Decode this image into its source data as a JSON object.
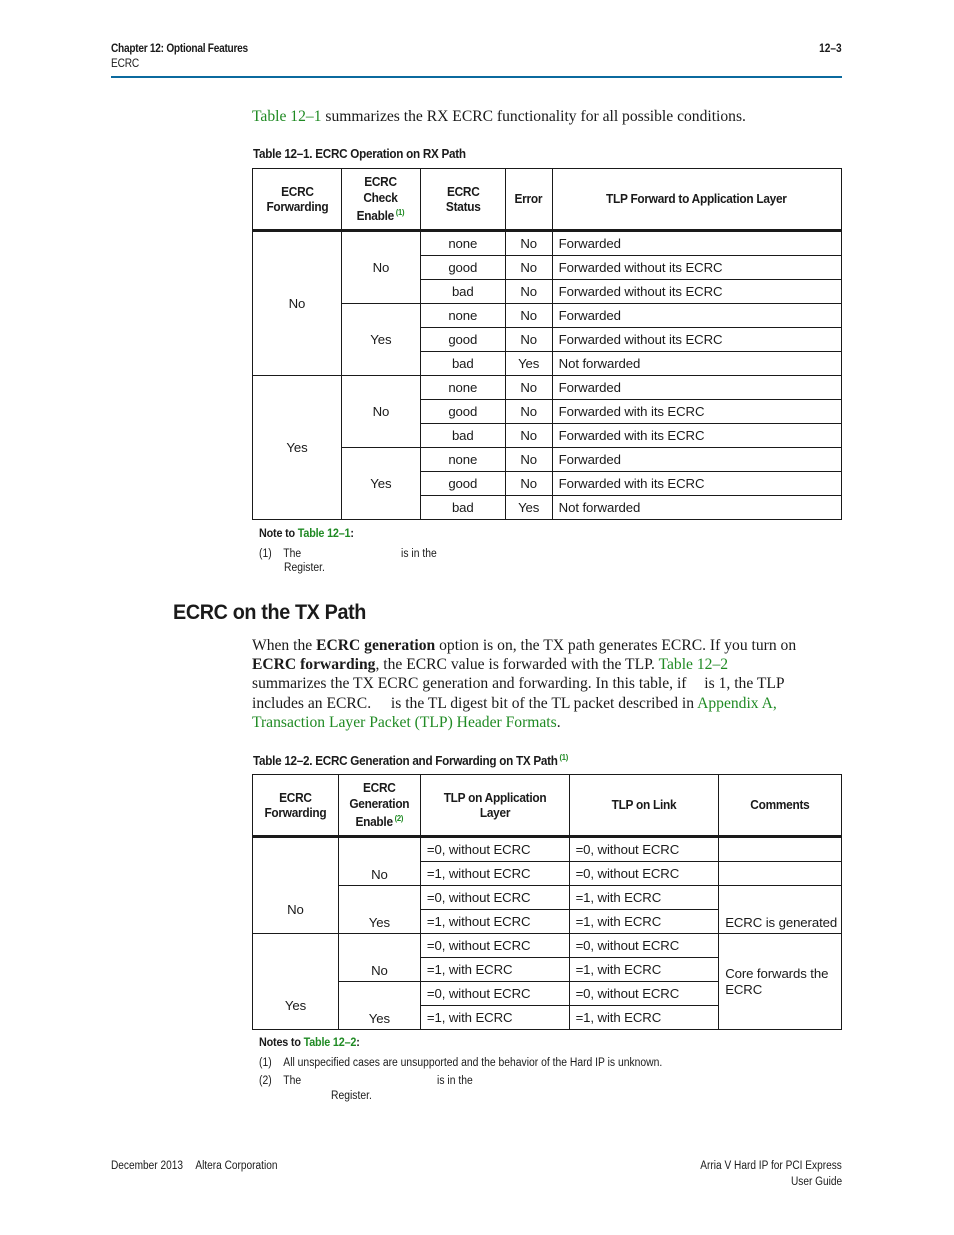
{
  "header": {
    "chapter": "Chapter 12:  Optional Features",
    "section": "ECRC",
    "page_number": "12–3",
    "rule_color": "#0b6a9e"
  },
  "intro": {
    "link": "Table 12–1",
    "text": " summarizes the RX ECRC functionality for all possible conditions."
  },
  "table1": {
    "caption": "Table 12–1.  ECRC Operation on RX Path",
    "headers": {
      "forwarding": [
        "ECRC",
        "Forwarding"
      ],
      "check_enable": [
        "ECRC",
        "Check",
        "Enable"
      ],
      "check_enable_note": "(1)",
      "status": [
        "ECRC",
        "Status"
      ],
      "error": "Error",
      "tlp_forward": "TLP Forward to Application Layer"
    },
    "groups": [
      {
        "forwarding": "No",
        "subgroups": [
          {
            "check_enable": "No",
            "rows": [
              {
                "status": "none",
                "error": "No",
                "result": "Forwarded"
              },
              {
                "status": "good",
                "error": "No",
                "result": "Forwarded without its ECRC"
              },
              {
                "status": "bad",
                "error": "No",
                "result": "Forwarded without its ECRC"
              }
            ]
          },
          {
            "check_enable": "Yes",
            "rows": [
              {
                "status": "none",
                "error": "No",
                "result": "Forwarded"
              },
              {
                "status": "good",
                "error": "No",
                "result": "Forwarded without its ECRC"
              },
              {
                "status": "bad",
                "error": "Yes",
                "result": "Not forwarded"
              }
            ]
          }
        ]
      },
      {
        "forwarding": "Yes",
        "subgroups": [
          {
            "check_enable": "No",
            "rows": [
              {
                "status": "none",
                "error": "No",
                "result": "Forwarded"
              },
              {
                "status": "good",
                "error": "No",
                "result": "Forwarded with its ECRC"
              },
              {
                "status": "bad",
                "error": "No",
                "result": "Forwarded with its ECRC"
              }
            ]
          },
          {
            "check_enable": "Yes",
            "rows": [
              {
                "status": "none",
                "error": "No",
                "result": "Forwarded"
              },
              {
                "status": "good",
                "error": "No",
                "result": "Forwarded with its ECRC"
              },
              {
                "status": "bad",
                "error": "Yes",
                "result": "Not forwarded"
              }
            ]
          }
        ]
      }
    ],
    "notes_title_prefix": "Note to ",
    "notes_title_link": "Table 12–1",
    "notes_title_suffix": ":",
    "notes": [
      {
        "num": "(1)",
        "line1_a": "The",
        "line1_b": "is in the",
        "line2": "Register."
      }
    ]
  },
  "section": {
    "title": "ECRC on the TX Path",
    "paragraph": {
      "l1_a": "When the ",
      "l1_bold": "ECRC generation",
      "l1_b": " option is on, the TX path generates ECRC. If you turn on",
      "l2_bold": "ECRC forwarding",
      "l2_a": ", the ECRC value is forwarded with the TLP. ",
      "l2_link": "Table 12–2",
      "l3_a": "summarizes the TX ECRC generation and forwarding. In this table, if ",
      "l3_b": " is 1, the TLP",
      "l4_a": "includes an ECRC. ",
      "l4_b": " is the TL digest bit of the TL packet described in ",
      "l4_link": "Appendix A,",
      "l5_link": "Transaction Layer Packet (TLP) Header Formats",
      "l5_end": "."
    }
  },
  "table2": {
    "caption": "Table 12–2.  ECRC Generation and Forwarding on TX Path",
    "caption_note": "(1)",
    "headers": {
      "forwarding": [
        "ECRC",
        "Forwarding"
      ],
      "gen_enable": [
        "ECRC",
        "Generation",
        "Enable"
      ],
      "gen_enable_note": "(2)",
      "app_layer": [
        "TLP on Application",
        "Layer"
      ],
      "link": "TLP on Link",
      "comments": "Comments"
    },
    "groups": [
      {
        "forwarding": "No",
        "subgroups": [
          {
            "gen_enable": "No",
            "rows": [
              {
                "app": "=0, without ECRC",
                "link": "=0, without ECRC"
              },
              {
                "app": "=1, without ECRC",
                "link": "=0, without ECRC"
              }
            ]
          },
          {
            "gen_enable": "Yes",
            "rows": [
              {
                "app": "=0, without ECRC",
                "link": "=1, with ECRC"
              },
              {
                "app": "=1, without ECRC",
                "link": "=1, with ECRC"
              }
            ]
          }
        ],
        "comments": [
          "",
          "",
          "ECRC is generated"
        ]
      },
      {
        "forwarding": "Yes",
        "subgroups": [
          {
            "gen_enable": "No",
            "rows": [
              {
                "app": "=0, without ECRC",
                "link": "=0, without ECRC"
              },
              {
                "app": "=1, with ECRC",
                "link": "=1, with ECRC"
              }
            ]
          },
          {
            "gen_enable": "Yes",
            "rows": [
              {
                "app": "=0, without ECRC",
                "link": "=0, without ECRC"
              },
              {
                "app": "=1, with ECRC",
                "link": "=1, with ECRC"
              }
            ]
          }
        ],
        "comments": [
          "Core forwards the",
          "ECRC"
        ]
      }
    ],
    "notes_title_prefix": "Notes to ",
    "notes_title_link": "Table 12–2",
    "notes_title_suffix": ":",
    "notes": [
      {
        "num": "(1)",
        "text": "All unspecified cases are unsupported and the behavior of the Hard IP is unknown."
      },
      {
        "num": "(2)",
        "line1_a": "The",
        "line1_b": "is in the",
        "line2": "Register."
      }
    ]
  },
  "footer": {
    "date": "December 2013",
    "company": "Altera Corporation",
    "doc_title": "Arria V Hard IP for PCI Express",
    "doc_subtitle": "User Guide"
  },
  "colors": {
    "link": "#1f8a23",
    "text": "#1a1a1a"
  }
}
